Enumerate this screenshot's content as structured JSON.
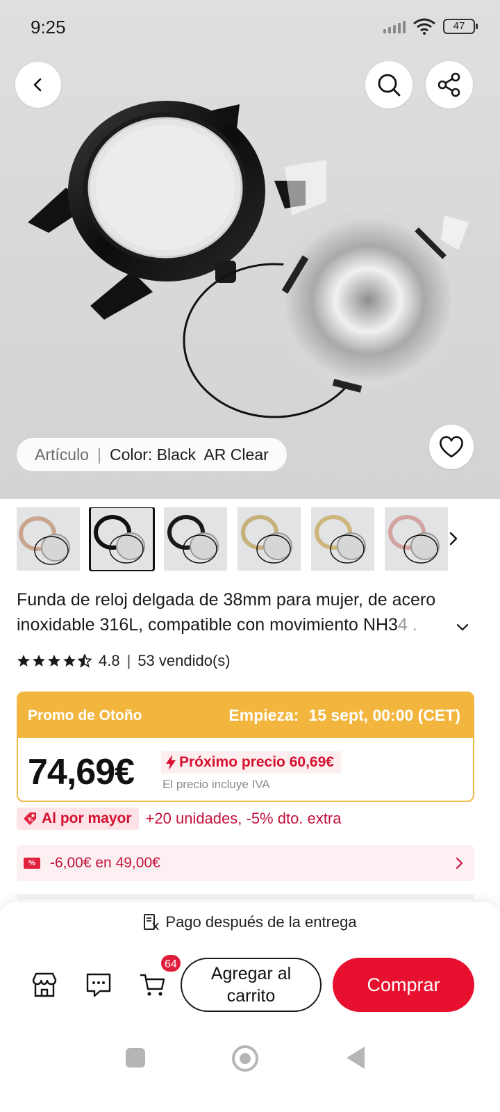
{
  "status_bar": {
    "time": "9:25",
    "battery": "47"
  },
  "hero": {
    "variant_label": "Artículo",
    "variant_value": "Color: Black  AR Clear"
  },
  "thumbnails": [
    "rose-gold",
    "black",
    "black",
    "gold",
    "gold",
    "pink"
  ],
  "product": {
    "title": "Funda de reloj delgada de 38mm para mujer, de acero inoxidable 316L, compatible con movimiento NH3",
    "title_faded": "4 .",
    "rating": "4.8",
    "sold": "53 vendido(s)"
  },
  "promo": {
    "name": "Promo de Otoño",
    "starts_label": "Empieza:",
    "starts_value": "15 sept, 00:00 (CET)",
    "price": "74,69€",
    "next_price": "Próximo precio 60,69€",
    "vat_note": "El precio incluye IVA"
  },
  "wholesale": {
    "tag": "Al por mayor",
    "text": "+20 unidades, -5% dto. extra"
  },
  "coupon": {
    "icon": "%",
    "text": "-6,00€ en 49,00€"
  },
  "bottom": {
    "pay_after": "Pago después de la entrega",
    "cart_badge": "64",
    "add_to_cart": "Agregar al carrito",
    "buy": "Comprar"
  },
  "colors": {
    "accent_red": "#e8102f",
    "promo_yellow": "#f2b63f",
    "price_red": "#d6102f"
  }
}
